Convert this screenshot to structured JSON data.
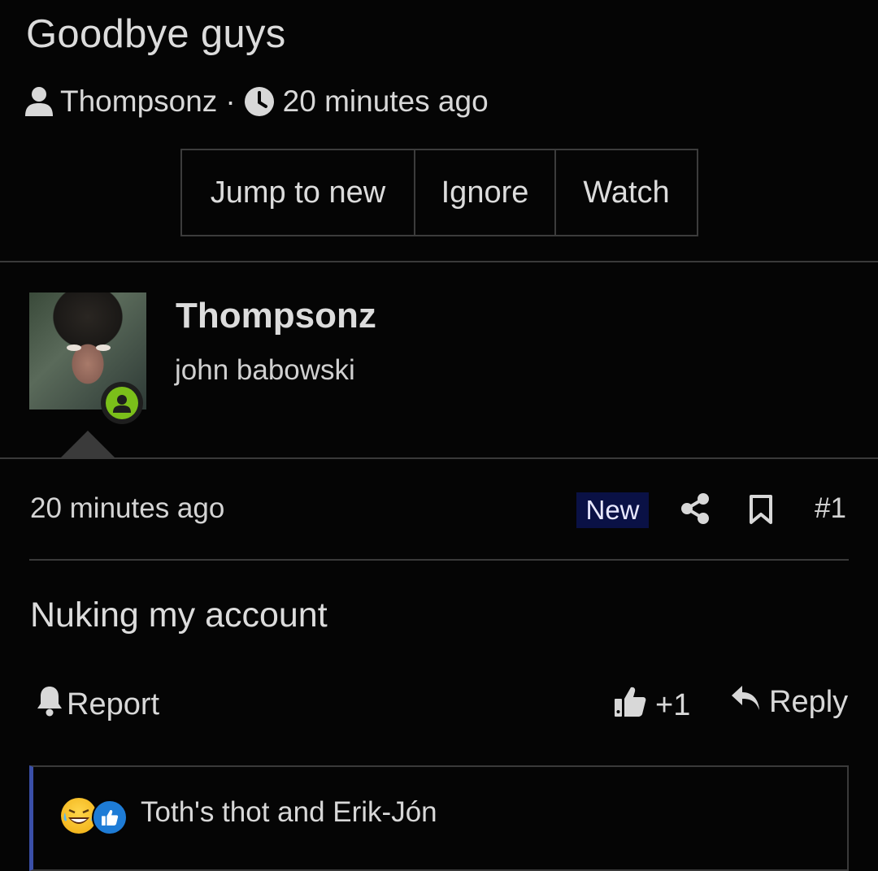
{
  "thread": {
    "title": "Goodbye guys",
    "author": "Thompsonz",
    "separator": "·",
    "time": "20 minutes ago"
  },
  "actions": {
    "jump_to_new": "Jump to new",
    "ignore": "Ignore",
    "watch": "Watch"
  },
  "post": {
    "username": "Thompsonz",
    "user_title": "john babowski",
    "time": "20 minutes ago",
    "badge": "New",
    "number": "#1",
    "body": "Nuking my account",
    "report_label": "Report",
    "like_count": "+1",
    "reply_label": "Reply",
    "reactions_text": "Toth's thot and Erik-Jón",
    "reaction_icons": [
      "laugh-emoji-icon",
      "like-emoji-icon"
    ]
  },
  "colors": {
    "background": "#050505",
    "new_badge": "#0a1145",
    "online": "#7bbf1a",
    "reaction_accent": "#3a4fa8"
  }
}
